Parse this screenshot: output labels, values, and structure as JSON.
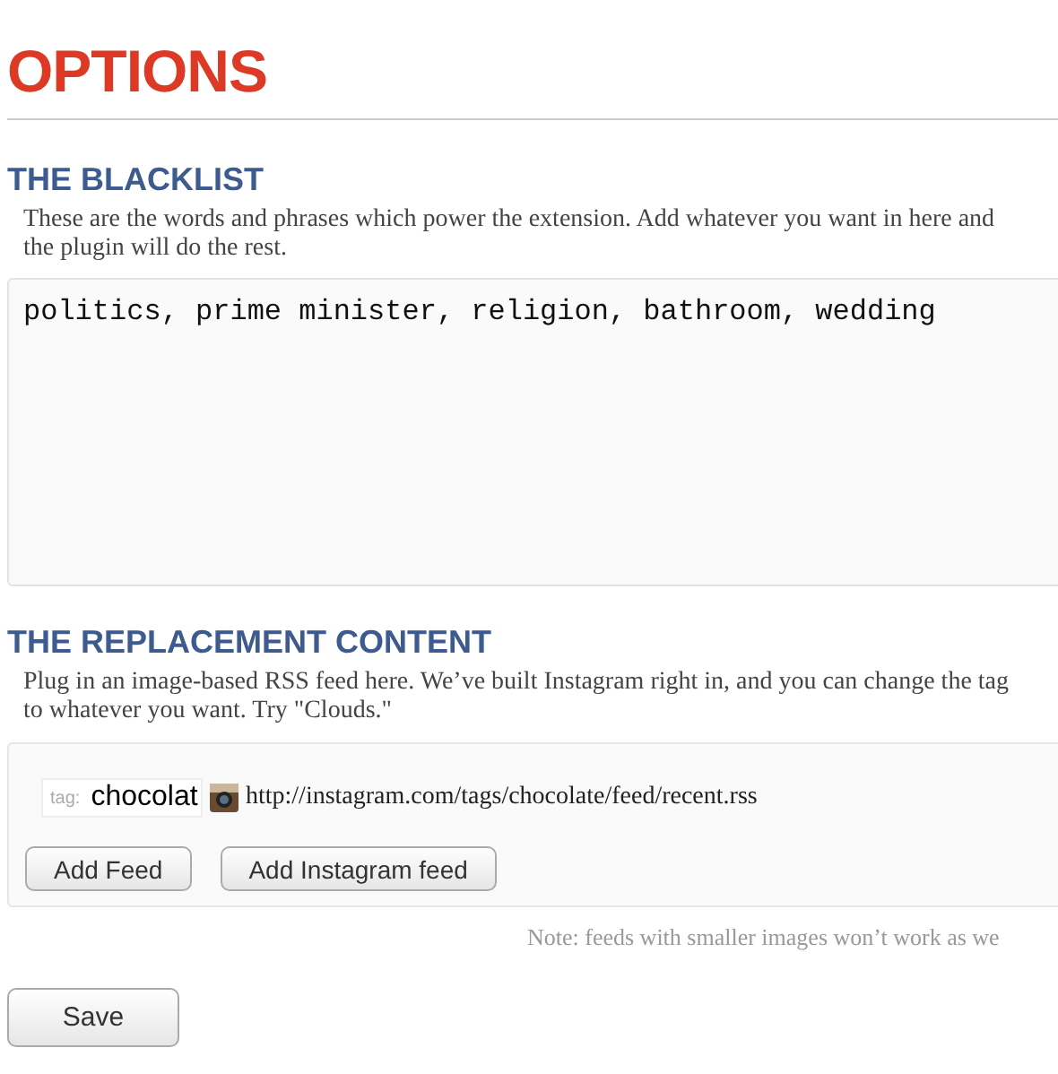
{
  "title": "OPTIONS",
  "blacklist": {
    "heading": "THE BLACKLIST",
    "description": [
      "These are the words and phrases which power the extension. Add whatever you want in here and",
      "the plugin will do the rest."
    ],
    "value": "politics, prime minister, religion, bathroom, wedding"
  },
  "replacement": {
    "heading": "THE REPLACEMENT CONTENT",
    "description": [
      "Plug in an image-based RSS feed here. We’ve built Instagram right in, and you can change the tag",
      "to whatever you want. Try \"Clouds.\""
    ],
    "feeds": [
      {
        "tag_label": "tag:",
        "tag_value": "chocolat",
        "url": "http://instagram.com/tags/chocolate/feed/recent.rss"
      }
    ],
    "buttons": [
      "Add Feed",
      "Add Instagram feed"
    ],
    "note": "Note: feeds with smaller images won’t work as we"
  },
  "save_button": "Save"
}
